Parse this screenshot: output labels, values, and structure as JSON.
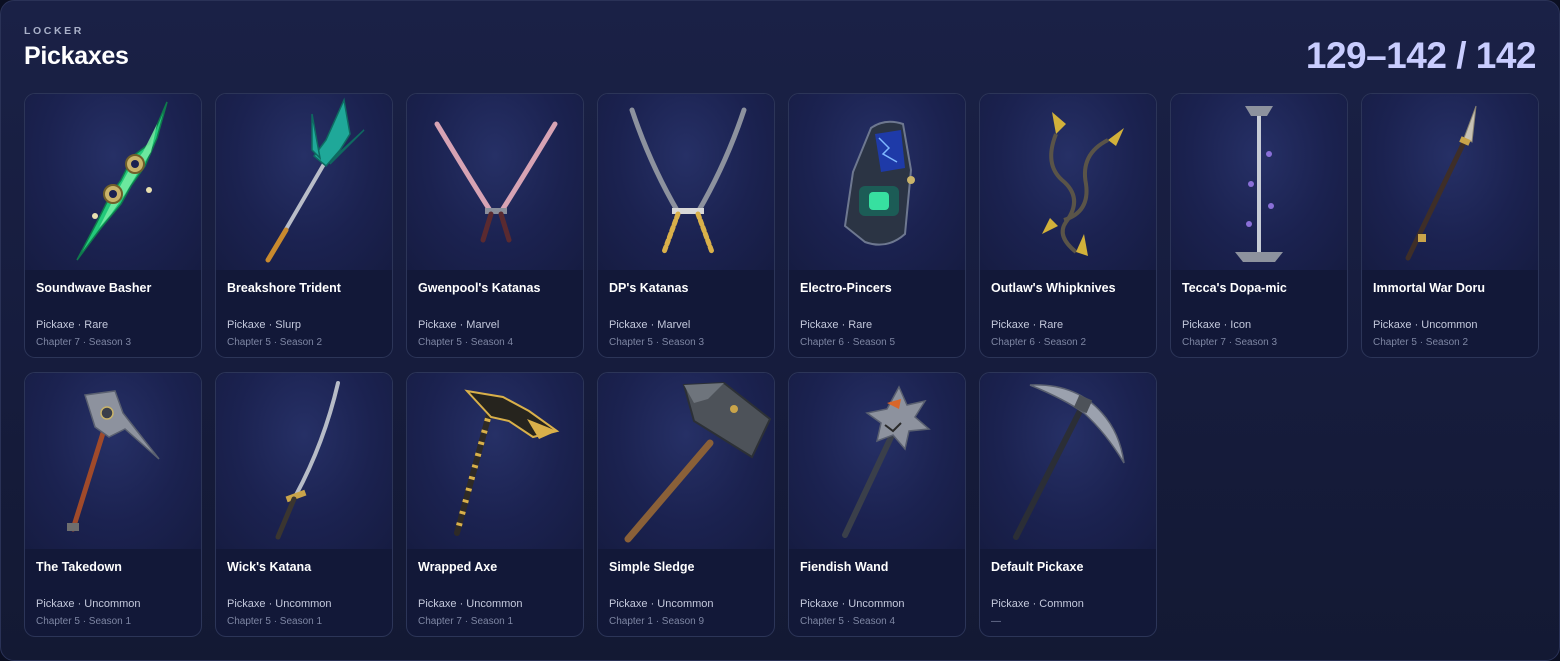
{
  "header": {
    "eyebrow": "LOCKER",
    "title": "Pickaxes",
    "counter": "129–142 / 142"
  },
  "items": [
    {
      "name": "Soundwave Basher",
      "meta": "Pickaxe · Rare",
      "season": "Chapter 7 · Season 3",
      "icon": "soundwave-basher-icon"
    },
    {
      "name": "Breakshore Trident",
      "meta": "Pickaxe · Slurp",
      "season": "Chapter 5 · Season 2",
      "icon": "breakshore-trident-icon"
    },
    {
      "name": "Gwenpool's Katanas",
      "meta": "Pickaxe · Marvel",
      "season": "Chapter 5 · Season 4",
      "icon": "gwenpool-katanas-icon"
    },
    {
      "name": "DP's Katanas",
      "meta": "Pickaxe · Marvel",
      "season": "Chapter 5 · Season 3",
      "icon": "dp-katanas-icon"
    },
    {
      "name": "Electro-Pincers",
      "meta": "Pickaxe · Rare",
      "season": "Chapter 6 · Season 5",
      "icon": "electro-pincers-icon"
    },
    {
      "name": "Outlaw's Whipknives",
      "meta": "Pickaxe · Rare",
      "season": "Chapter 6 · Season 2",
      "icon": "outlaw-whipknives-icon"
    },
    {
      "name": "Tecca's Dopa-mic",
      "meta": "Pickaxe · Icon",
      "season": "Chapter 7 · Season 3",
      "icon": "tecca-dopa-mic-icon"
    },
    {
      "name": "Immortal War Doru",
      "meta": "Pickaxe · Uncommon",
      "season": "Chapter 5 · Season 2",
      "icon": "immortal-war-doru-icon"
    },
    {
      "name": "The Takedown",
      "meta": "Pickaxe · Uncommon",
      "season": "Chapter 5 · Season 1",
      "icon": "the-takedown-icon"
    },
    {
      "name": "Wick's Katana",
      "meta": "Pickaxe · Uncommon",
      "season": "Chapter 5 · Season 1",
      "icon": "wicks-katana-icon"
    },
    {
      "name": "Wrapped Axe",
      "meta": "Pickaxe · Uncommon",
      "season": "Chapter 7 · Season 1",
      "icon": "wrapped-axe-icon"
    },
    {
      "name": "Simple Sledge",
      "meta": "Pickaxe · Uncommon",
      "season": "Chapter 1 · Season 9",
      "icon": "simple-sledge-icon"
    },
    {
      "name": "Fiendish Wand",
      "meta": "Pickaxe · Uncommon",
      "season": "Chapter 5 · Season 4",
      "icon": "fiendish-wand-icon"
    },
    {
      "name": "Default Pickaxe",
      "meta": "Pickaxe · Common",
      "season": "—",
      "icon": "default-pickaxe-icon"
    }
  ]
}
